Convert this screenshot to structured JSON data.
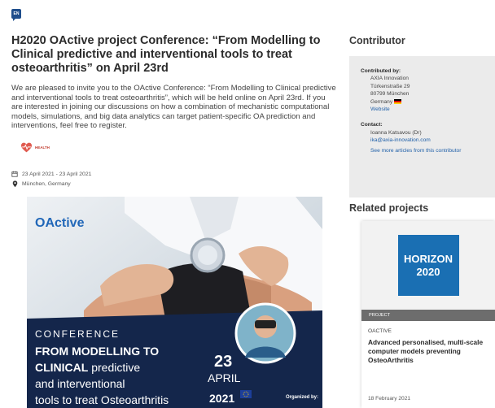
{
  "language": "EN",
  "article": {
    "title": "H2020 OActive project Conference: “From Modelling to Clinical predictive and interventional tools to treat osteoarthritis” on April 23rd",
    "intro": "We are pleased to invite you to the OActive Conference: “From Modelling to Clinical predictive and interventional tools to treat osteoarthritis”, which will be held online on April 23rd. If you are interested in joining our discussions on how a combination of mechanistic computational models, simulations, and big data analytics can target patient-specific OA prediction and interventions, feel free to register.",
    "tag": "HEALTH",
    "date": "23 April 2021 - 23 April 2021",
    "location": "München, Germany"
  },
  "poster": {
    "logo": "OActive",
    "line1": "CONFERENCE",
    "line2": "FROM MODELLING TO",
    "line3_bold": "CLINICAL",
    "line3_rest": " predictive",
    "line4": "and interventional",
    "line5": "tools to treat Osteoarthritis",
    "day": "23",
    "month": "APRIL",
    "year": "2021",
    "organized_by": "Organized by:"
  },
  "sidebar": {
    "contributor_heading": "Contributor",
    "contributed_by_label": "Contributed by:",
    "org": "AXIA Innovation",
    "street": "Türkenstraße 29",
    "city": "80799 München",
    "country": "Germany",
    "website": "Website",
    "contact_label": "Contact:",
    "contact_name": "Ioanna Katsavou (Dr)",
    "contact_email": "ika@axia-innovation.com",
    "more_link": "See more articles from this contributor",
    "related_heading": "Related projects"
  },
  "project": {
    "logo_line1": "HORIZON",
    "logo_line2": "2020",
    "badge": "PROJECT",
    "category": "OACTIVE",
    "title": "Advanced personalised, multi-scale computer models preventing OsteoArthritis",
    "date": "18 February 2021"
  },
  "colors": {
    "accent": "#1f4e8c",
    "link": "#1f5fa8",
    "poster_navy": "#14264b",
    "health": "#c0392b",
    "horizon": "#1a6fb3"
  }
}
